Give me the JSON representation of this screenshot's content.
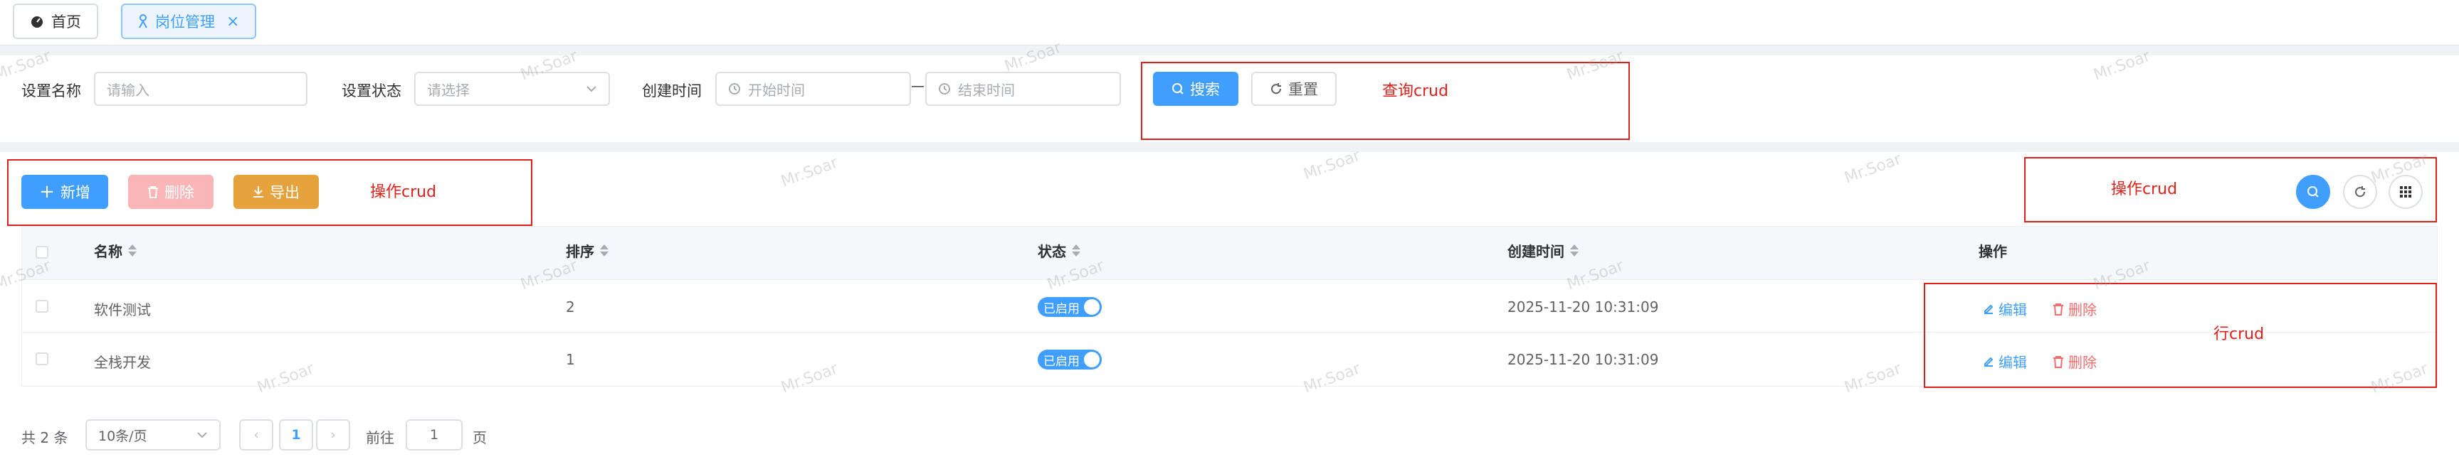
{
  "tags": [
    {
      "label": "首页",
      "icon": "dashboard-icon"
    },
    {
      "label": "岗位管理",
      "icon": "person-icon",
      "close": "×"
    }
  ],
  "search": {
    "name_label": "设置名称",
    "name_placeholder": "请输入",
    "status_label": "设置状态",
    "status_placeholder": "请选择",
    "time_label": "创建时间",
    "start_placeholder": "开始时间",
    "range_sep": "—",
    "end_placeholder": "结束时间",
    "search_button": "搜索",
    "reset_button": "重置"
  },
  "toolbar": {
    "add_button": "新增",
    "delete_button": "删除",
    "export_button": "导出"
  },
  "table": {
    "columns": [
      "名称",
      "排序",
      "状态",
      "创建时间",
      "操作"
    ],
    "rows": [
      {
        "name": "软件测试",
        "sort": "2",
        "status": "已启用",
        "created": "2025-11-20 10:31:09",
        "edit": "编辑",
        "delete": "删除"
      },
      {
        "name": "全栈开发",
        "sort": "1",
        "status": "已启用",
        "created": "2025-11-20 10:31:09",
        "edit": "编辑",
        "delete": "删除"
      }
    ]
  },
  "pagination": {
    "total": "共 2 条",
    "page_size": "10条/页",
    "current_page": "1",
    "goto_label": "前往",
    "goto_value": "1",
    "page_unit": "页"
  },
  "annotations": {
    "query": "查询crud",
    "operation_left": "操作crud",
    "operation_right": "操作crud",
    "row": "行crud"
  },
  "watermark": "Mr.Soar",
  "colors": {
    "primary": "#409eff",
    "danger": "#f56c6c",
    "warning": "#e6a23c",
    "annotation": "#e0201a"
  }
}
